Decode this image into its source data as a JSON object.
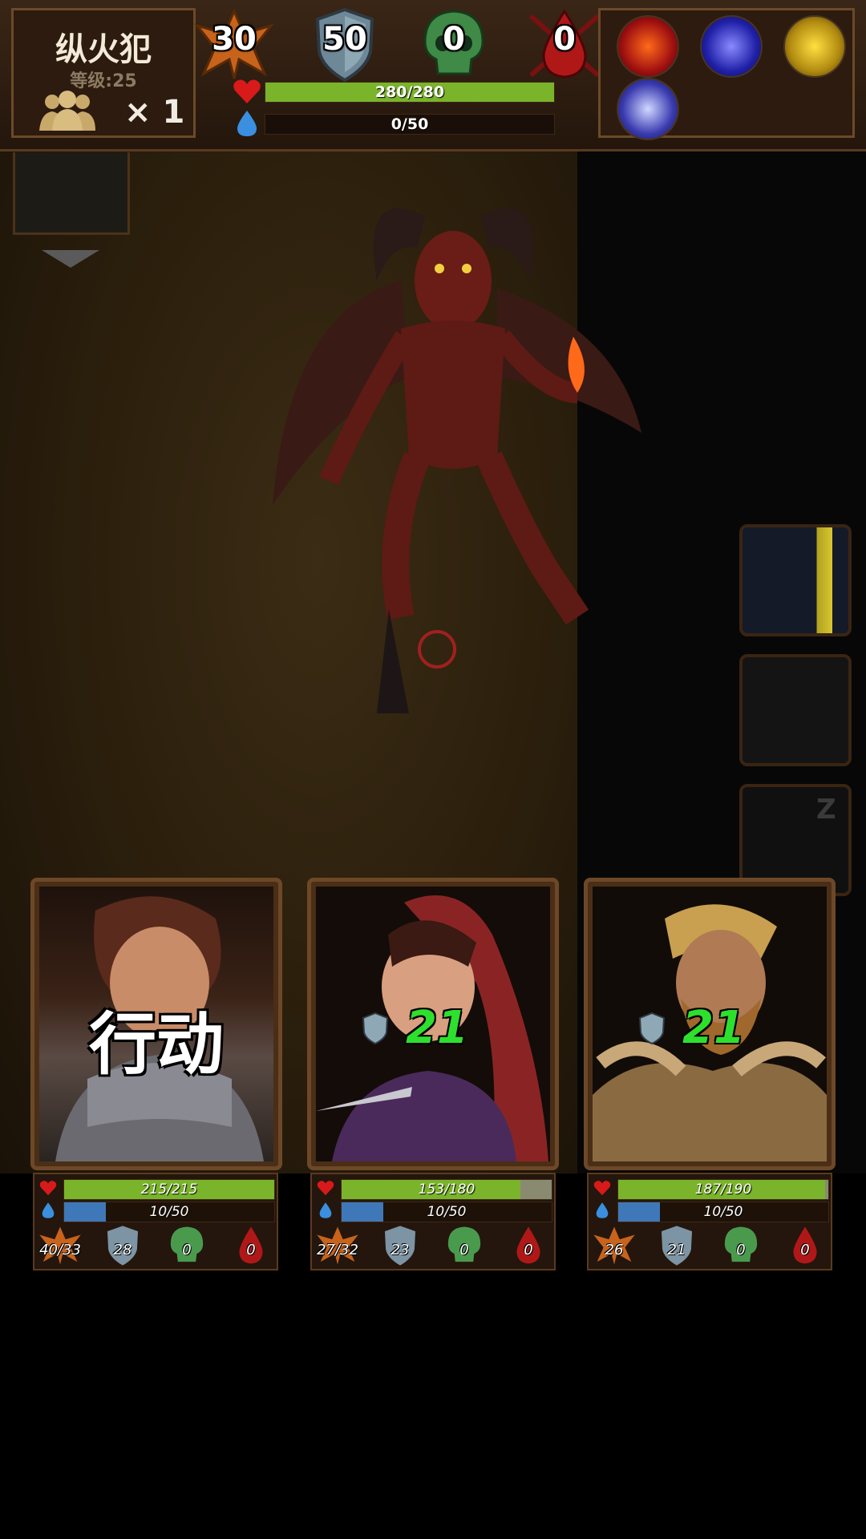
{
  "enemy": {
    "name": "纵火犯",
    "level": "等级:25",
    "group_count": "× 1",
    "stats": {
      "attack": "30",
      "armor": "50",
      "poison": "0",
      "bleed": "0"
    },
    "hp": {
      "text": "280/280",
      "fraction": 1.0
    },
    "mp": {
      "text": "0/50",
      "fraction": 0.0
    }
  },
  "skills": [
    "fire-swirl-skill-icon",
    "lightning-skill-icon",
    "strike-skill-icon",
    "vortex-skill-icon"
  ],
  "heroes": [
    {
      "id": "warrior",
      "action_label": "行动",
      "hp": {
        "text": "215/215",
        "fraction": 1.0
      },
      "mp": {
        "text": "10/50",
        "fraction": 0.2
      },
      "attack": "40/33",
      "armor": "28",
      "poison": "0",
      "bleed": "0"
    },
    {
      "id": "rogue",
      "armor_overlay": "21",
      "hp": {
        "text": "153/180",
        "fraction": 0.85
      },
      "mp": {
        "text": "10/50",
        "fraction": 0.2
      },
      "attack": "27/32",
      "armor": "23",
      "poison": "0",
      "bleed": "0"
    },
    {
      "id": "barbarian",
      "armor_overlay": "21",
      "hp": {
        "text": "187/190",
        "fraction": 0.984
      },
      "mp": {
        "text": "10/50",
        "fraction": 0.2
      },
      "attack": "26",
      "armor": "21",
      "poison": "0",
      "bleed": "0"
    }
  ],
  "colors": {
    "hp": "#7ab42a",
    "mp": "#3f78b8",
    "poison": "#4a9a4e",
    "bleed": "#b01818",
    "attack": "#d07a22",
    "armor": "#7c94a4"
  }
}
